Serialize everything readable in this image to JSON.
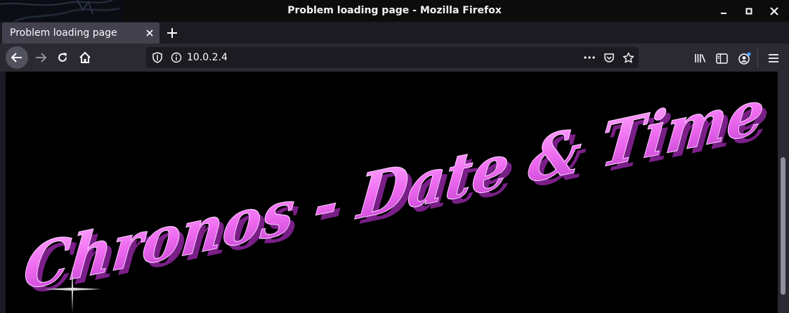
{
  "window": {
    "title": "Problem loading page - Mozilla Firefox"
  },
  "tabs": [
    {
      "label": "Problem loading page",
      "active": true
    }
  ],
  "urlbar": {
    "url": "10.0.2.4"
  },
  "page": {
    "heading": "Chronos - Date & Time",
    "heading_color": "#ee7bf2"
  },
  "colors": {
    "titlebar": "#0c0c0d",
    "toolbar": "#2b2a33",
    "tab_active": "#42414d",
    "page_background": "#000000"
  },
  "icons": {
    "back": "arrow-left-icon",
    "forward": "arrow-right-icon",
    "reload": "reload-icon",
    "home": "home-icon",
    "shield": "tracking-shield-icon",
    "info": "info-icon",
    "more": "ellipsis-icon",
    "pocket": "pocket-icon",
    "bookmark": "star-icon",
    "library": "library-icon",
    "sidebar": "sidebar-icon",
    "account": "account-icon",
    "menu": "hamburger-menu-icon"
  }
}
